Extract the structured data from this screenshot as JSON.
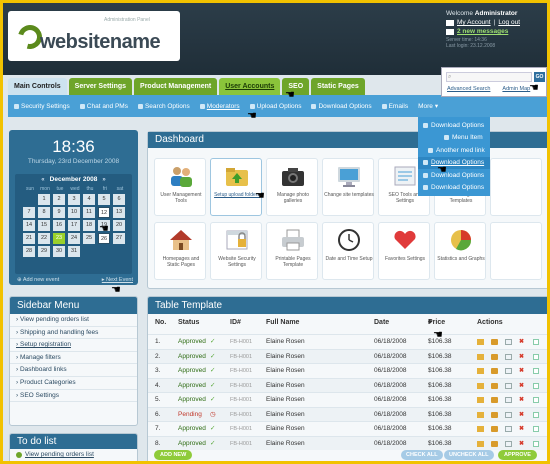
{
  "logo": {
    "name": "websitename",
    "tagline": "Administration Panel"
  },
  "user": {
    "welcome": "Welcome",
    "name": "Administrator",
    "my_account": "My Account",
    "separator": "|",
    "logout": "Log out",
    "messages": "2 new messages",
    "server_time_label": "Server time:",
    "server_time": "14:36",
    "last_login_label": "Last login:",
    "last_login_value": "23.12.2008"
  },
  "search": {
    "placeholder": "",
    "go_label": "GO",
    "advanced": "Advanced Search",
    "admin_map": "Admin Map"
  },
  "tabs": [
    {
      "label": "Main Controls"
    },
    {
      "label": "Server Settings"
    },
    {
      "label": "Product Management"
    },
    {
      "label": "User Accounts"
    },
    {
      "label": "SEO"
    },
    {
      "label": "Static Pages"
    }
  ],
  "subnav": [
    {
      "label": "Security Settings"
    },
    {
      "label": "Chat and PMs"
    },
    {
      "label": "Search Options"
    },
    {
      "label": "Moderators"
    },
    {
      "label": "Upload Options"
    },
    {
      "label": "Download Options"
    },
    {
      "label": "Emails"
    },
    {
      "label": "More"
    }
  ],
  "dropdown": [
    {
      "label": "Download Options"
    },
    {
      "label": "Menu Item"
    },
    {
      "label": "Another med link"
    },
    {
      "label": "Download Options"
    },
    {
      "label": "Download Options"
    },
    {
      "label": "Download Options"
    }
  ],
  "clock": {
    "time": "18:36",
    "date": "Thursday, 23rd December 2008"
  },
  "calendar": {
    "month": "December 2008",
    "prev": "«",
    "next": "»",
    "days": [
      "sun",
      "mon",
      "tue",
      "wed",
      "thu",
      "fri",
      "sat"
    ],
    "cells": [
      "",
      "1",
      "2",
      "3",
      "4",
      "5",
      "6",
      "7",
      "8",
      "9",
      "10",
      "11",
      "12",
      "13",
      "14",
      "15",
      "16",
      "17",
      "18",
      "19",
      "20",
      "21",
      "22",
      "23",
      "24",
      "25",
      "26",
      "27",
      "28",
      "29",
      "30",
      "31",
      "",
      "",
      ""
    ],
    "event_days": [
      "12",
      "26"
    ],
    "today": "23",
    "add_event": "Add new event",
    "next_event": "Next Event"
  },
  "sidebar_menu": {
    "title": "Sidebar Menu",
    "items": [
      "View pending orders list",
      "Shipping and handling fees",
      "Setup registration",
      "Manage filters",
      "Dashboard links",
      "Product Categories",
      "SEO Settings"
    ]
  },
  "todo": {
    "title": "To do list",
    "items": [
      "View pending orders list"
    ]
  },
  "dashboard": {
    "title": "Dashboard",
    "items": [
      {
        "label": "User Management Tools",
        "icon": "users-icon"
      },
      {
        "label": "Setup upload folders",
        "icon": "folder-upload-icon"
      },
      {
        "label": "Manage photo galleries",
        "icon": "camera-icon"
      },
      {
        "label": "Change site templates",
        "icon": "monitor-icon"
      },
      {
        "label": "SEO Tools and Settings",
        "icon": "seo-icon"
      },
      {
        "label": "Email Settings and Templates",
        "icon": "email-icon"
      },
      {
        "label": "",
        "icon": "blank"
      },
      {
        "label": "Homepages and Static Pages",
        "icon": "home-icon"
      },
      {
        "label": "Website Security Settings",
        "icon": "security-icon"
      },
      {
        "label": "Printable Pages Template",
        "icon": "printer-icon"
      },
      {
        "label": "Date and Time Setup",
        "icon": "clock-icon"
      },
      {
        "label": "Favorites Settings",
        "icon": "heart-icon"
      },
      {
        "label": "Statistics and Graphs",
        "icon": "pie-icon"
      },
      {
        "label": "",
        "icon": "blank"
      }
    ]
  },
  "table": {
    "title": "Table Template",
    "headers": {
      "no": "No.",
      "status": "Status",
      "id": "ID#",
      "name": "Full Name",
      "date": "Date",
      "price": "Price",
      "actions": "Actions"
    },
    "rows": [
      {
        "no": "1.",
        "status": "Approved",
        "id": "FB-H001",
        "name": "Elaine Rosen",
        "date": "06/18/2008",
        "price": "$106.38"
      },
      {
        "no": "2.",
        "status": "Approved",
        "id": "FB-H001",
        "name": "Elaine Rosen",
        "date": "06/18/2008",
        "price": "$106.38"
      },
      {
        "no": "3.",
        "status": "Approved",
        "id": "FB-H001",
        "name": "Elaine Rosen",
        "date": "06/18/2008",
        "price": "$106.38"
      },
      {
        "no": "4.",
        "status": "Approved",
        "id": "FB-H001",
        "name": "Elaine Rosen",
        "date": "06/18/2008",
        "price": "$106.38"
      },
      {
        "no": "5.",
        "status": "Approved",
        "id": "FB-H001",
        "name": "Elaine Rosen",
        "date": "06/18/2008",
        "price": "$106.38"
      },
      {
        "no": "6.",
        "status": "Pending",
        "id": "FB-H001",
        "name": "Elaine Rosen",
        "date": "06/18/2008",
        "price": "$106.38"
      },
      {
        "no": "7.",
        "status": "Approved",
        "id": "FB-H001",
        "name": "Elaine Rosen",
        "date": "06/18/2008",
        "price": "$106.38"
      },
      {
        "no": "8.",
        "status": "Approved",
        "id": "FB-H001",
        "name": "Elaine Rosen",
        "date": "06/18/2008",
        "price": "$106.38"
      }
    ],
    "add_new": "ADD NEW",
    "check_all": "CHECK ALL",
    "uncheck_all": "UNCHECK ALL",
    "approve": "APPROVE"
  },
  "colors": {
    "green": "#6ea52a",
    "blue": "#4aa0d6",
    "dark": "#2e6d93",
    "frame": "#f2c200"
  }
}
